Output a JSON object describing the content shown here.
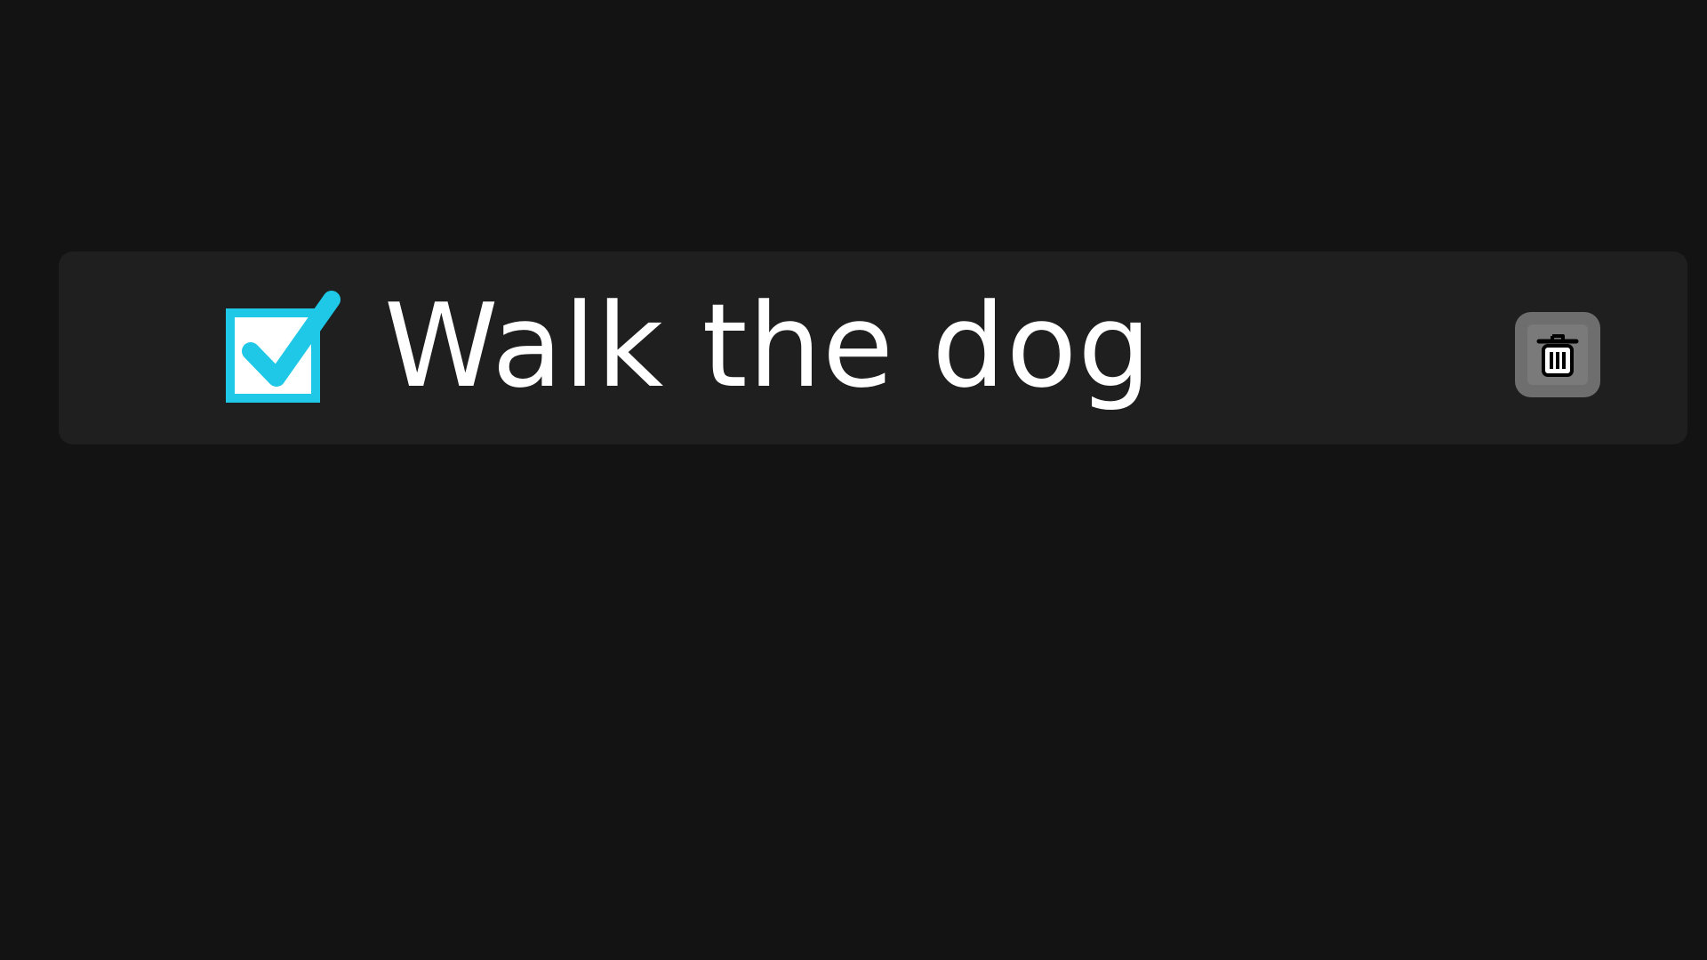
{
  "todo": {
    "task_text": "Walk the dog",
    "completed": true,
    "delete_icon": "trash-icon",
    "checkbox_icon": "checkbox-checked-icon"
  },
  "colors": {
    "background": "#131313",
    "row_background": "#1f1f1f",
    "checkbox_accent": "#1ec8e6",
    "text": "#ffffff",
    "delete_button": "#6e6e6e"
  }
}
